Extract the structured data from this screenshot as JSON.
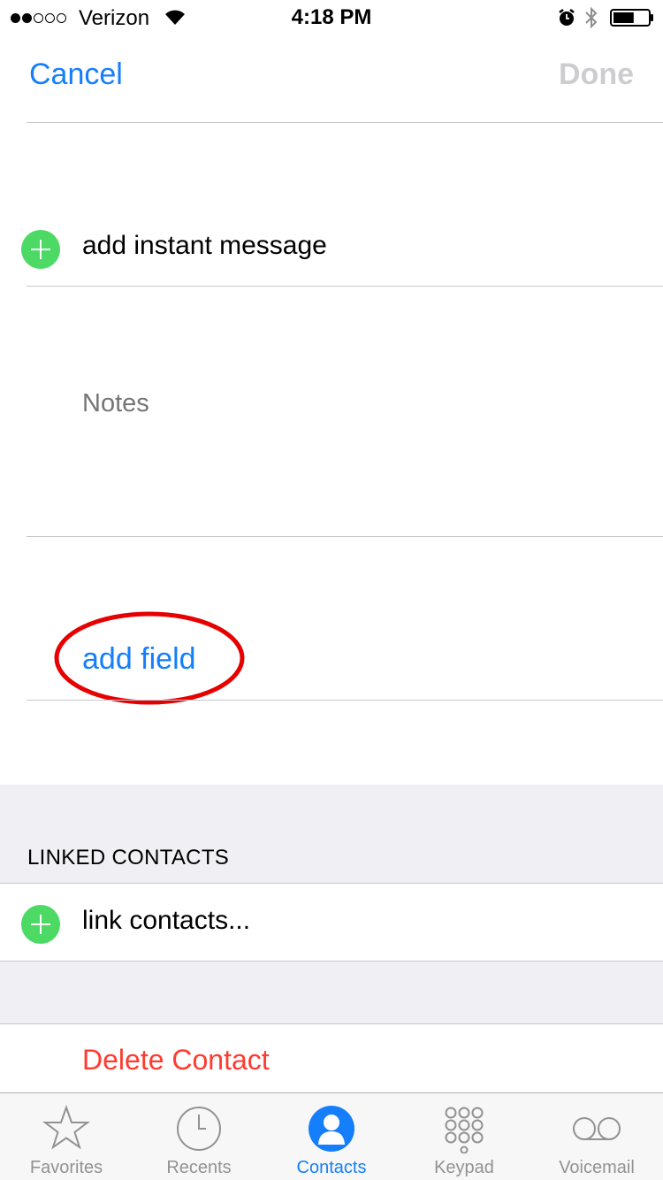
{
  "status_bar": {
    "signal_bars_filled": 2,
    "signal_bars_total": 5,
    "carrier": "Verizon",
    "time": "4:18 PM",
    "battery_level": 0.6
  },
  "nav": {
    "cancel_label": "Cancel",
    "done_label": "Done"
  },
  "form": {
    "add_instant_message_label": "add instant message",
    "notes_placeholder": "Notes",
    "add_field_label": "add field"
  },
  "linked_contacts": {
    "header": "LINKED CONTACTS",
    "link_contacts_label": "link contacts..."
  },
  "delete_label": "Delete Contact",
  "tab_bar": {
    "tabs": [
      {
        "label": "Favorites",
        "icon": "star-icon",
        "active": false
      },
      {
        "label": "Recents",
        "icon": "clock-icon",
        "active": false
      },
      {
        "label": "Contacts",
        "icon": "contacts-icon",
        "active": true
      },
      {
        "label": "Keypad",
        "icon": "keypad-icon",
        "active": false
      },
      {
        "label": "Voicemail",
        "icon": "voicemail-icon",
        "active": false
      }
    ]
  },
  "colors": {
    "accent": "#157efb",
    "destructive": "#ff3b30",
    "add_green": "#4cd964",
    "annotation_red": "#e60000",
    "inactive_tab": "#929292",
    "section_background": "#efeff4"
  }
}
